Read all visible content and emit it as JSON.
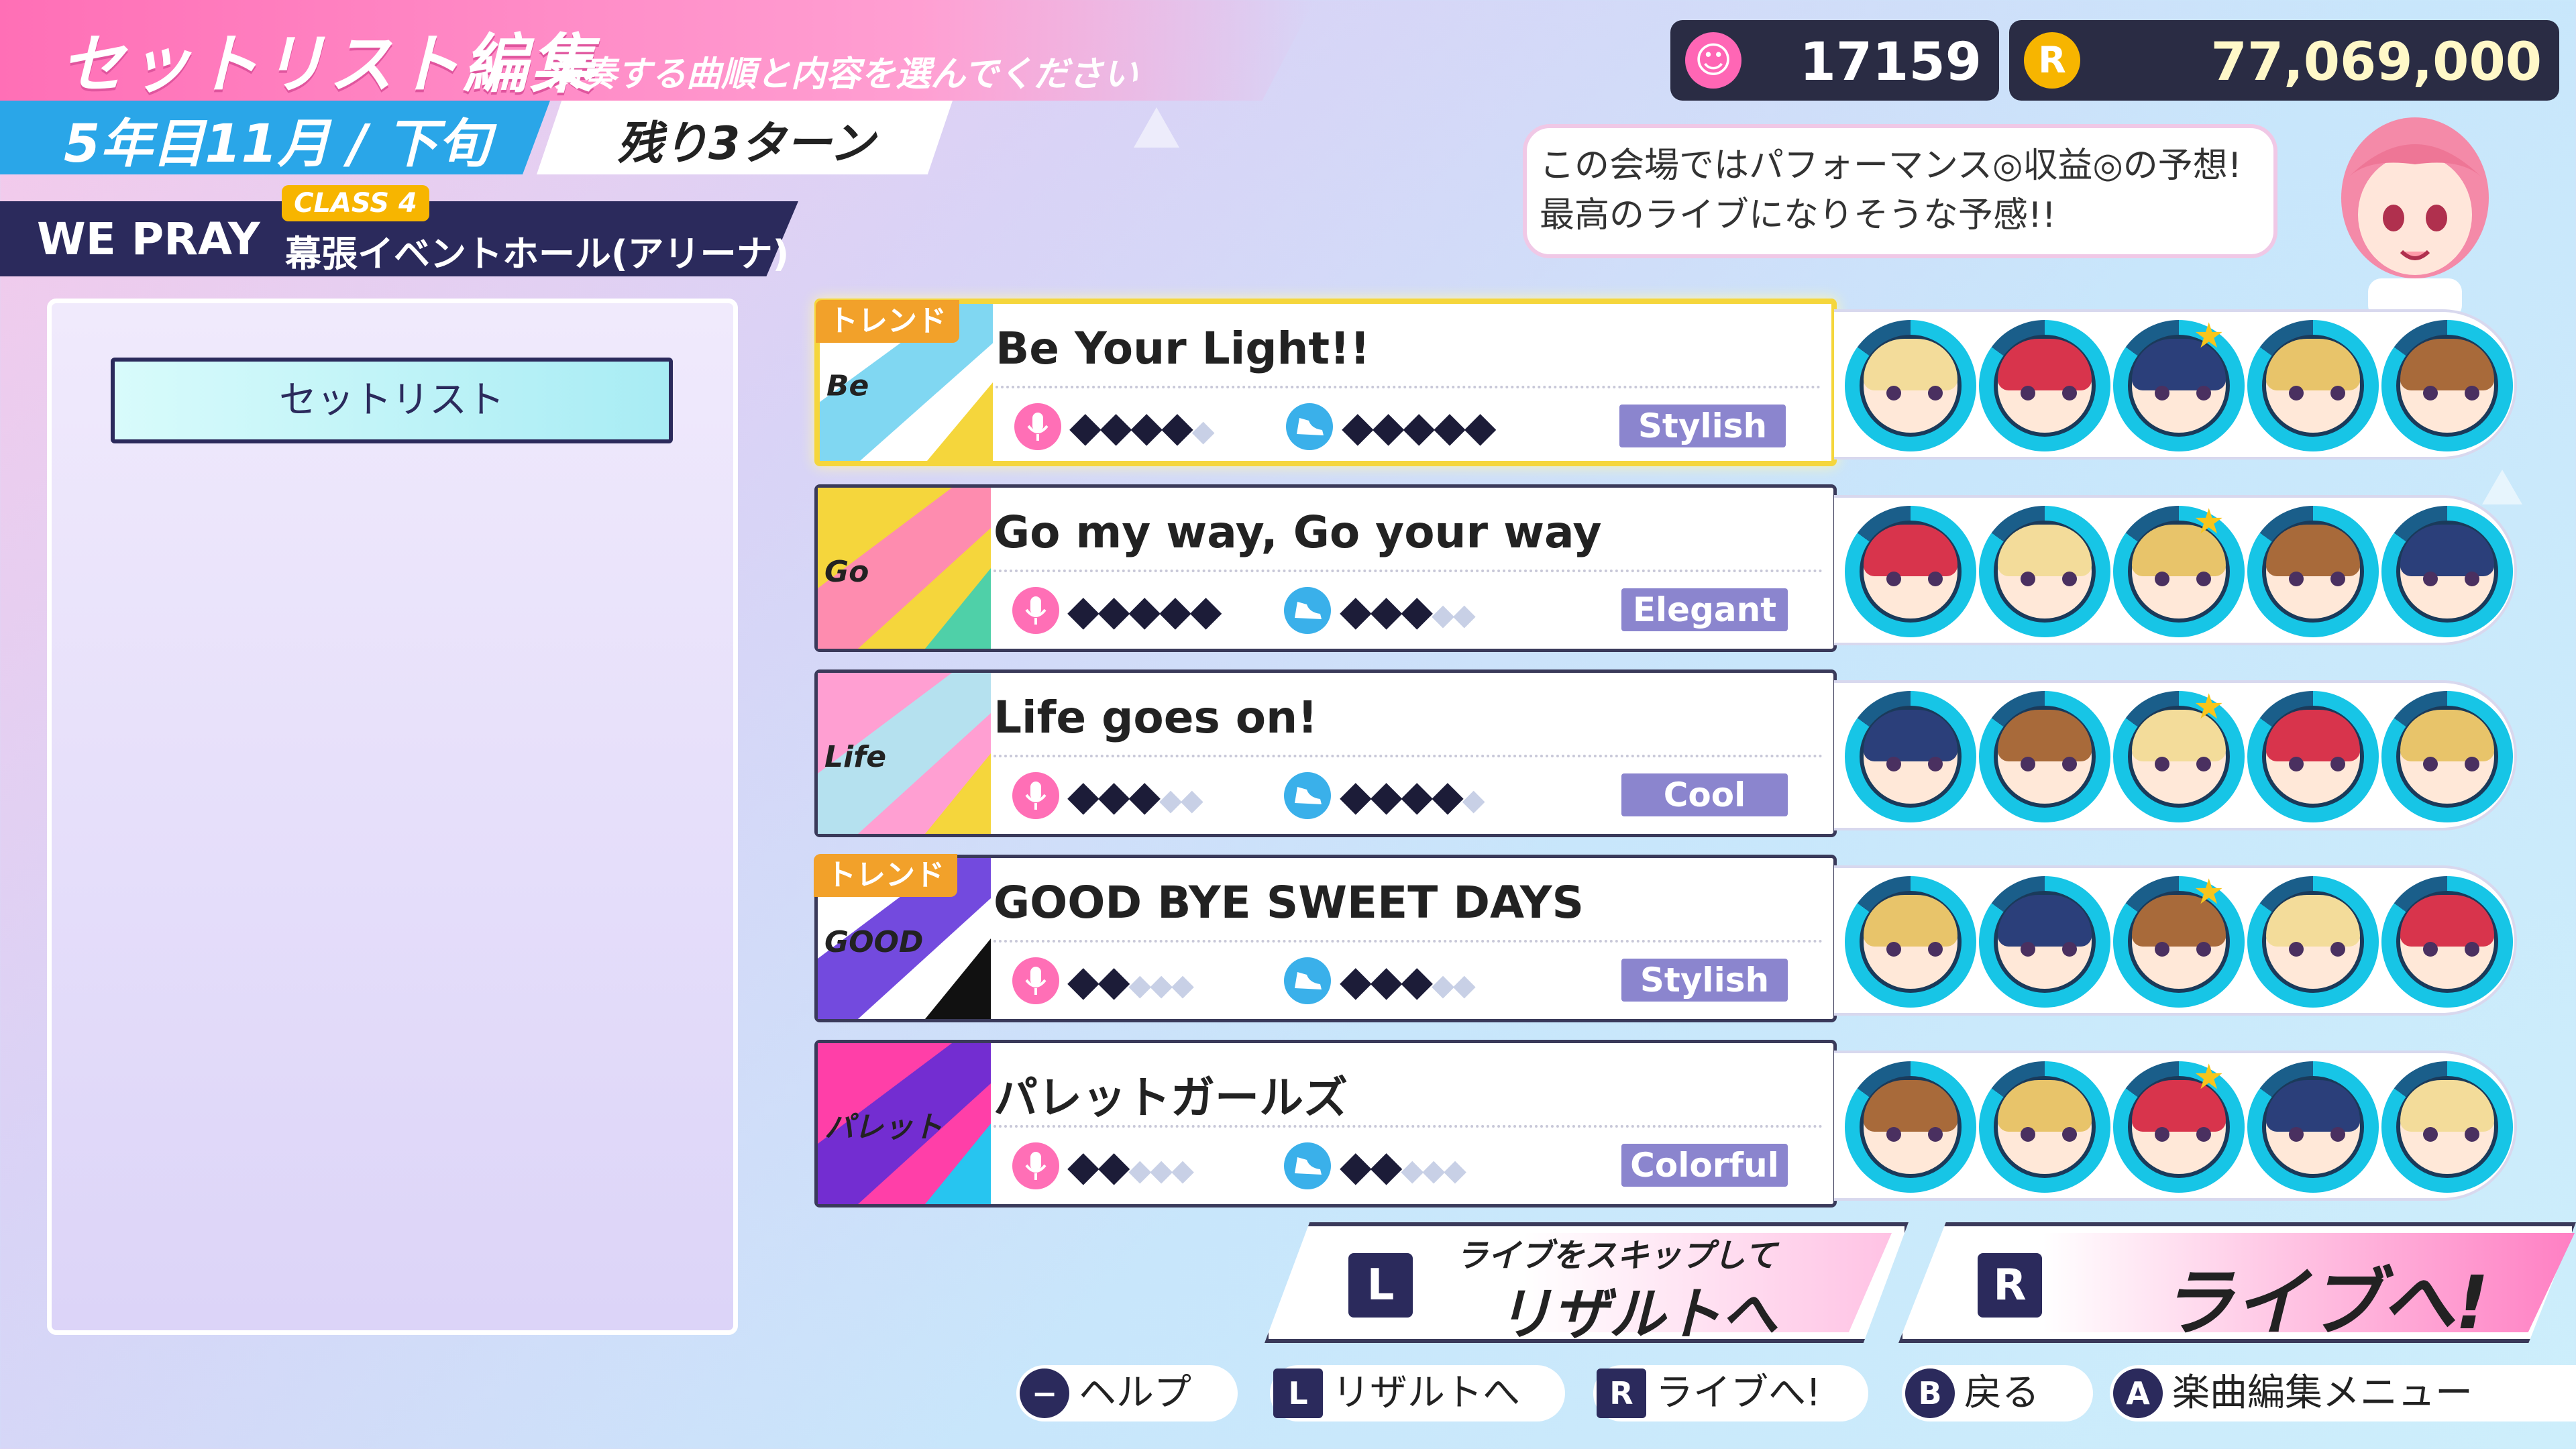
{
  "header": {
    "title": "セットリスト編集",
    "subtitle": "演奏する曲順と内容を選んでください",
    "date": "5年目11月 / 下旬",
    "turns_left": "残り3ターン",
    "group": "WE PRAY",
    "class_badge": "CLASS 4",
    "venue": "幕張イベントホール(アリーナ)"
  },
  "currency": {
    "fans": "17159",
    "money": "77,069,000",
    "fans_icon": "smile-icon",
    "money_icon": "coin-icon"
  },
  "speech": {
    "line1": "この会場ではパフォーマンス◎収益◎の予想!",
    "line2": "最高のライブになりそうな予感!!"
  },
  "left_panel": {
    "setlist_button": "セットリスト"
  },
  "songs": [
    {
      "title": "Be Your Light!!",
      "trend": "トレンド",
      "vocal": 4,
      "dance": 5,
      "genre": "Stylish",
      "genre_color": "#8b85ce",
      "jacket_text": "Be your Li",
      "jacket_colors": [
        "#ffffff",
        "#6ad0f0",
        "#f5d63c"
      ],
      "members": [
        {
          "hair": "#f3dc9a"
        },
        {
          "hair": "#d8344c"
        },
        {
          "hair": "#2b3f7a",
          "star": true
        },
        {
          "hair": "#e8c46a"
        },
        {
          "hair": "#a86a3a"
        }
      ]
    },
    {
      "title": "Go my way, Go your way",
      "trend": "",
      "vocal": 5,
      "dance": 3,
      "genre": "Elegant",
      "genre_color": "#8b85ce",
      "jacket_text": "Go my way Go your",
      "jacket_colors": [
        "#f5d63c",
        "#ff7fc3",
        "#4fd0a8"
      ],
      "members": [
        {
          "hair": "#d8344c"
        },
        {
          "hair": "#f3dc9a"
        },
        {
          "hair": "#e8c46a",
          "star": true
        },
        {
          "hair": "#a86a3a"
        },
        {
          "hair": "#2b3f7a"
        }
      ]
    },
    {
      "title": "Life goes on!",
      "trend": "",
      "vocal": 3,
      "dance": 4,
      "genre": "Cool",
      "genre_color": "#8b85ce",
      "jacket_text": "Life goes",
      "jacket_colors": [
        "#ff9fd2",
        "#a8ecf4",
        "#f5d63c"
      ],
      "members": [
        {
          "hair": "#2b3f7a"
        },
        {
          "hair": "#a86a3a"
        },
        {
          "hair": "#f3dc9a",
          "star": true
        },
        {
          "hair": "#d8344c"
        },
        {
          "hair": "#e8c46a"
        }
      ]
    },
    {
      "title": "GOOD BYE SWEET DAYS",
      "trend": "トレンド",
      "vocal": 2,
      "dance": 3,
      "genre": "Stylish",
      "genre_color": "#8b85ce",
      "jacket_text": "GOOD BY SWEET DAYS",
      "jacket_colors": [
        "#ffffff",
        "#5a2ad8",
        "#111111"
      ],
      "members": [
        {
          "hair": "#e8c46a"
        },
        {
          "hair": "#2b3f7a"
        },
        {
          "hair": "#a86a3a",
          "star": true
        },
        {
          "hair": "#f3dc9a"
        },
        {
          "hair": "#d8344c"
        }
      ]
    },
    {
      "title": "パレットガールズ",
      "trend": "",
      "vocal": 2,
      "dance": 2,
      "genre": "Colorful",
      "genre_color": "#8b85ce",
      "jacket_text": "パレット ガール PALETTE GI",
      "jacket_colors": [
        "#ff3fa8",
        "#5a2ad8",
        "#27c5f0"
      ],
      "members": [
        {
          "hair": "#a86a3a"
        },
        {
          "hair": "#e8c46a"
        },
        {
          "hair": "#d8344c",
          "star": true
        },
        {
          "hair": "#2b3f7a"
        },
        {
          "hair": "#f3dc9a"
        }
      ]
    }
  ],
  "buttons": {
    "skip_key": "L",
    "skip_small": "ライブをスキップして",
    "skip_big": "リザルトへ",
    "live_key": "R",
    "live_big": "ライブへ!"
  },
  "help_bar": [
    {
      "key": "−",
      "shape": "round",
      "label": "ヘルプ"
    },
    {
      "key": "L",
      "shape": "sq",
      "label": "リザルトへ"
    },
    {
      "key": "R",
      "shape": "sq",
      "label": "ライブへ!"
    },
    {
      "key": "B",
      "shape": "round",
      "label": "戻る"
    },
    {
      "key": "A",
      "shape": "round",
      "label": "楽曲編集メニュー"
    }
  ]
}
